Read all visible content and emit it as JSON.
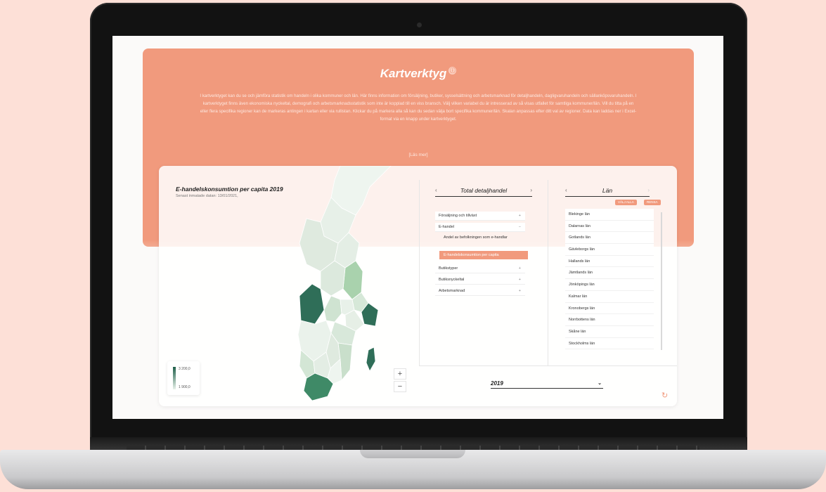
{
  "banner": {
    "title": "Kartverktyg",
    "info_icon": "ⓘ",
    "text": "I kartverktyget kan du se och jämföra statistik om handeln i olika kommuner och län. Här finns information om försäljning, butiker, sysselsättning och arbetsmarknad för detaljhandeln, dagligvaruhandeln och sällanköpsvaruhandeln. I kartverktyget finns även ekonomiska nyckeltal, demografi och arbetsmarknadsstatistik som inte är kopplad till en viss bransch. Välj vilken variabel du är intresserad av så visas utfallet för samtliga kommuner/län. Vill du titta på en eller flera specifika regioner kan de markeras antingen i kartan eller via rullistan. Klickar du på markera alla så kan du sedan välja bort specifika kommuner/län. Skalan anpassas efter ditt val av regioner. Data kan laddas ner i Excel-format via en knapp under kartverktyget.",
    "read_more": "[Läs mer]"
  },
  "map": {
    "title": "E-handelskonsumtion per capita 2019",
    "subtitle": "Senast inmatade datan: 13/01/2021,",
    "legend_max": "3 200,0",
    "legend_min": "1 900,0",
    "zoom_in": "+",
    "zoom_out": "−"
  },
  "variables": {
    "header": "Total detaljhandel",
    "prev": "‹",
    "next": "›",
    "items": [
      {
        "label": "Försäljning och tillväxt",
        "toggle": "+"
      },
      {
        "label": "E-handel",
        "toggle": "−"
      },
      {
        "label": "Butikstyper",
        "toggle": "+"
      },
      {
        "label": "Butiksnyckeltal",
        "toggle": "+"
      },
      {
        "label": "Arbetsmarknad",
        "toggle": "+"
      }
    ],
    "sub_item": "Andel av befolkningen som e-handlar",
    "active_item": "E-handelskonsumtion per capita"
  },
  "lan": {
    "header": "Län",
    "prev": "‹",
    "next": "›",
    "select_all": "VÄLJ ALLA",
    "clear": "RENSA",
    "items": [
      "Blekinge län",
      "Dalarnas län",
      "Gotlands län",
      "Gävleborgs län",
      "Hallands län",
      "Jämtlands län",
      "Jönköpings län",
      "Kalmar län",
      "Kronobergs län",
      "Norrbottens län",
      "Skåne län",
      "Stockholms län"
    ]
  },
  "year": {
    "value": "2019",
    "chevron": "⌄"
  },
  "reset_icon": "↻",
  "colors": {
    "accent": "#f19a7d",
    "map_dark": "#1e5e49",
    "map_light": "#e9f2ea"
  }
}
